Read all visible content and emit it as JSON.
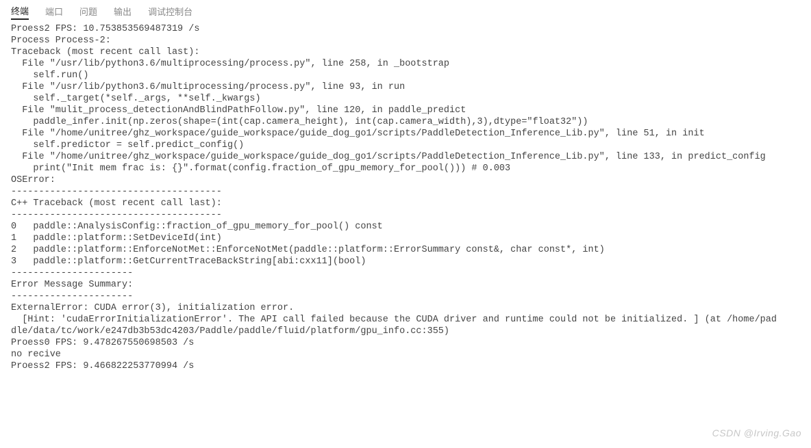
{
  "tabs": {
    "terminal": "终端",
    "ports": "端口",
    "problems": "问题",
    "output": "输出",
    "debug_console": "调试控制台"
  },
  "active_tab": "terminal",
  "terminal_lines": [
    "Proess2 FPS: 10.753853569487319 /s",
    "Process Process-2:",
    "Traceback (most recent call last):",
    "  File \"/usr/lib/python3.6/multiprocessing/process.py\", line 258, in _bootstrap",
    "    self.run()",
    "  File \"/usr/lib/python3.6/multiprocessing/process.py\", line 93, in run",
    "    self._target(*self._args, **self._kwargs)",
    "  File \"mulit_process_detectionAndBlindPathFollow.py\", line 120, in paddle_predict",
    "    paddle_infer.init(np.zeros(shape=(int(cap.camera_height), int(cap.camera_width),3),dtype=\"float32\"))",
    "  File \"/home/unitree/ghz_workspace/guide_workspace/guide_dog_go1/scripts/PaddleDetection_Inference_Lib.py\", line 51, in init",
    "    self.predictor = self.predict_config()",
    "  File \"/home/unitree/ghz_workspace/guide_workspace/guide_dog_go1/scripts/PaddleDetection_Inference_Lib.py\", line 133, in predict_config",
    "    print(\"Init mem frac is: {}\".format(config.fraction_of_gpu_memory_for_pool())) # 0.003",
    "OSError:",
    "",
    "--------------------------------------",
    "C++ Traceback (most recent call last):",
    "--------------------------------------",
    "0   paddle::AnalysisConfig::fraction_of_gpu_memory_for_pool() const",
    "1   paddle::platform::SetDeviceId(int)",
    "2   paddle::platform::EnforceNotMet::EnforceNotMet(paddle::platform::ErrorSummary const&, char const*, int)",
    "3   paddle::platform::GetCurrentTraceBackString[abi:cxx11](bool)",
    "",
    "----------------------",
    "Error Message Summary:",
    "----------------------",
    "ExternalError: CUDA error(3), initialization error.",
    "  [Hint: 'cudaErrorInitializationError'. The API call failed because the CUDA driver and runtime could not be initialized. ] (at /home/pad",
    "dle/data/tc/work/e247db3b53dc4203/Paddle/paddle/fluid/platform/gpu_info.cc:355)",
    "",
    "Proess0 FPS: 9.478267550698503 /s",
    "no recive",
    "Proess2 FPS: 9.466822253770994 /s"
  ],
  "watermark": "CSDN @Irving.Gao"
}
